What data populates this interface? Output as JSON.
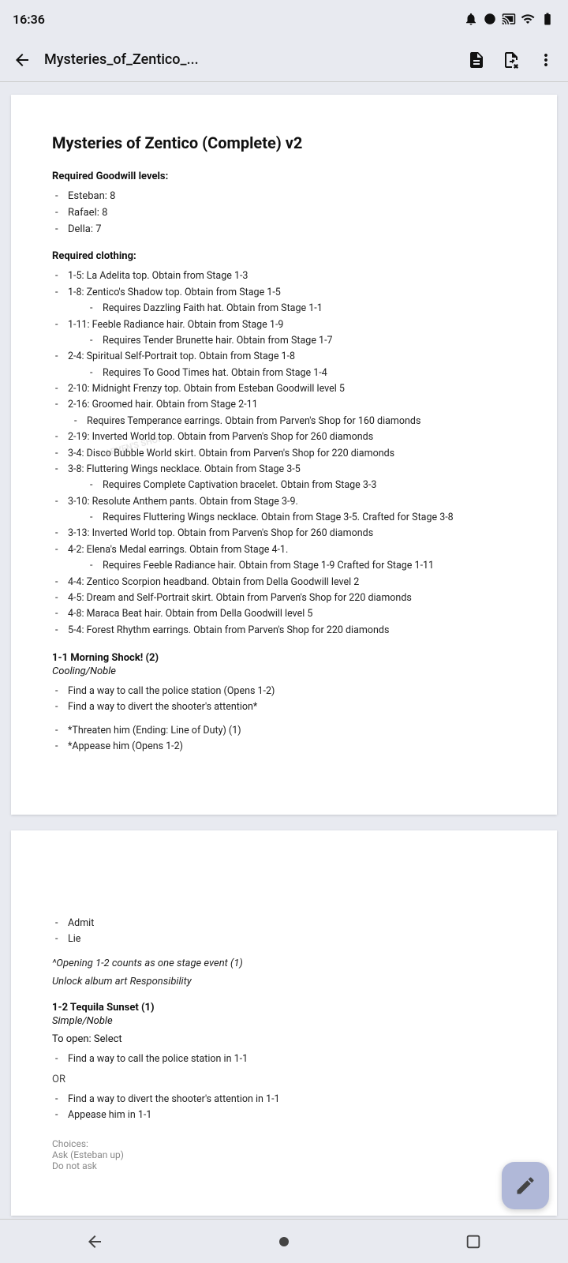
{
  "status_bar": {
    "time": "16:36",
    "notification_icon": "notification",
    "circle_icon": "circle"
  },
  "app_bar": {
    "title": "Mysteries_of_Zentico_...",
    "back_label": "←",
    "more_label": "⋮"
  },
  "document": {
    "title": "Mysteries of Zentico (Complete) v2",
    "section_goodwill": {
      "heading": "Required Goodwill levels:",
      "items": [
        {
          "text": "Esteban: 8"
        },
        {
          "text": "Rafael: 8"
        },
        {
          "text": "Della: 7"
        }
      ]
    },
    "section_clothing": {
      "heading": "Required clothing:",
      "items": [
        {
          "text": "1-5: La Adelita top. Obtain from Stage 1-3",
          "sub": null
        },
        {
          "text": "1-8: Zentico's Shadow top. Obtain from Stage 1-5",
          "sub": "Requires Dazzling Faith hat. Obtain from Stage 1-1"
        },
        {
          "text": "1-11: Feeble Radiance hair. Obtain from Stage 1-9",
          "sub": "Requires Tender Brunette hair. Obtain from Stage 1-7"
        },
        {
          "text": "2-4: Spiritual Self-Portrait top. Obtain from Stage 1-8",
          "sub": "Requires To Good Times hat. Obtain from Stage 1-4"
        },
        {
          "text": "2-10: Midnight Frenzy top. Obtain from Esteban Goodwill level 5",
          "sub": null
        },
        {
          "text": "2-16: Groomed hair. Obtain from Stage 2-11",
          "sub": null
        },
        {
          "text": "— Requires Temperance earrings. Obtain from Parven's Shop for 160 diamonds",
          "sub": null,
          "indent": true
        },
        {
          "text": "2-19: Inverted World top. Obtain from Parven's Shop for 260 diamonds",
          "sub": null
        },
        {
          "text": "3-4: Disco Bubble World skirt. Obtain from Parven's Shop for 220 diamonds",
          "sub": null
        },
        {
          "text": "3-8: Fluttering Wings necklace. Obtain from Stage 3-5",
          "sub": null
        },
        {
          "text": "— Requires Complete Captivation bracelet. Obtain from Stage 3-3",
          "sub": null,
          "indent": true
        },
        {
          "text": "3-10: Resolute Anthem pants. Obtain from Stage 3-9.",
          "sub": "Requires Fluttering Wings necklace. Obtain from Stage 3-5. Crafted for Stage 3-8"
        },
        {
          "text": "3-13: Inverted World top. Obtain from Parven's Shop for 260 diamonds",
          "sub": null
        },
        {
          "text": "4-2: Elena's Medal earrings. Obtain from Stage 4-1.",
          "sub": "Requires Feeble Radiance hair. Obtain from Stage 1-9 Crafted for Stage 1-11"
        },
        {
          "text": "4-4: Zentico Scorpion headband. Obtain from Della Goodwill level 2",
          "sub": null
        },
        {
          "text": "4-5: Dream and Self-Portrait skirt. Obtain from Parven's Shop for 220 diamonds",
          "sub": null
        },
        {
          "text": "4-8: Maraca Beat hair. Obtain from Della Goodwill level 5",
          "sub": null
        },
        {
          "text": "5-4: Forest Rhythm earrings. Obtain from Parven's Shop for 220 diamonds",
          "sub": null
        }
      ]
    },
    "stage_1_1": {
      "heading": "1-1 Morning Shock! (2)",
      "style": "Cooling/Noble",
      "tasks": [
        "Find a way to call the police station (Opens 1-2)",
        "Find a way to divert the shooter's attention*"
      ],
      "choices": [
        "*Threaten him (Ending: Line of Duty) (1)",
        "*Appease him (Opens 1-2)"
      ]
    }
  },
  "page2": {
    "list_items": [
      {
        "text": "Admit"
      },
      {
        "text": "Lie"
      }
    ],
    "note": "^Opening 1-2 counts as one stage event (1)",
    "unlock": "Unlock album art Responsibility",
    "stage_1_2": {
      "heading": "1-2 Tequila Sunset (1)",
      "style": "Simple/Noble",
      "to_open": "To open: Select",
      "task": "Find a way to call the police station in 1-1",
      "or_label": "OR",
      "or_tasks": [
        "Find a way to divert the shooter's attention in 1-1",
        "Appease him in 1-1"
      ],
      "choices_label": "Choices:",
      "choices_sub1": "Ask (Esteban up)",
      "choices_sub2": "Do not ask"
    }
  },
  "fab": {
    "icon": "edit-icon"
  },
  "nav_bar": {
    "back_icon": "nav-back-icon",
    "home_icon": "nav-home-icon",
    "recents_icon": "nav-recents-icon"
  }
}
